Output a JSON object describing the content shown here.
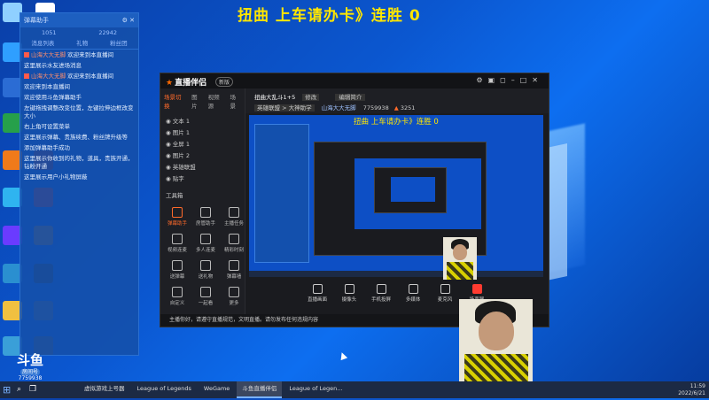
{
  "stream_overlay_title": "扭曲 上车请办卡》连胜 0",
  "chat_panel": {
    "header_title": "弹幕助手",
    "stats": [
      "1051",
      "22942"
    ],
    "tabs": [
      "消息列表",
      "礼物",
      "粉丝团"
    ],
    "messages": [
      {
        "user": "山海大大无脚",
        "text": "欢迎来到本直播间"
      },
      {
        "user": "",
        "text": "这里展示水友进场消息"
      },
      {
        "user": "山海大大无脚",
        "text": "欢迎来到本直播间"
      },
      {
        "user": "",
        "text": "欢迎来到本直播间"
      },
      {
        "user": "",
        "text": "欢迎使用斗鱼弹幕助手"
      },
      {
        "user": "",
        "text": "左键拖拽调整改变位置，左键拉伸边框改变大小"
      },
      {
        "user": "",
        "text": "右上角可设置菜单"
      },
      {
        "user": "",
        "text": "这里展示弹幕、贵族续费、粉丝牌升级等"
      },
      {
        "user": "",
        "text": "添加弹幕助手成功"
      },
      {
        "user": "",
        "text": "这里展示你收到的礼物，道具，贵族开通，钻粉开通"
      },
      {
        "user": "",
        "text": "这里展示用户小礼物屏蔽"
      }
    ]
  },
  "app": {
    "name": "直播伴侣",
    "version_badge": "新版",
    "sidebar_tabs": [
      "场景切换",
      "图片",
      "视频源",
      "场景"
    ],
    "layers": [
      "文本 1",
      "图片 1",
      "全屏 1",
      "图片 2",
      "英雄联盟",
      "贴字"
    ],
    "tools_header": "工具箱",
    "tools": [
      "弹幕助手",
      "房管助手",
      "主播任务",
      "视频连麦",
      "多人连麦",
      "精彩时刻",
      "送弹幕",
      "送礼物",
      "弹幕墙",
      "自定义",
      "一起看",
      "更多"
    ],
    "room_title": "扭曲大乱斗1+5",
    "room_edit": "修改",
    "room_tag": "编辑简介",
    "room_category": "英雄联盟 > 大神助学",
    "room_user": "山海大大无脚",
    "room_id": "7759938",
    "room_hot": "3251",
    "controls": [
      "直播画面",
      "摄像头",
      "手机投屏",
      "多媒体",
      "麦克风",
      "扬声器"
    ],
    "status_text": "主播你好，请遵守直播规范，文明直播。请勿发布任何违规内容"
  },
  "douyu_badge": {
    "logo": "斗鱼",
    "label": "房间号",
    "room": "7759938"
  },
  "taskbar": {
    "items": [
      "虚拟游戏上号器",
      "League of Legends",
      "WeGame",
      "斗鱼直播伴侣",
      "League of Legen..."
    ],
    "active_index": 3,
    "time": "11:59",
    "date": "2022/6/21"
  },
  "colors": {
    "overlay_yellow": "#ffe600",
    "accent_orange": "#ff6a2a",
    "desktop_blue": "#0b57d0"
  }
}
